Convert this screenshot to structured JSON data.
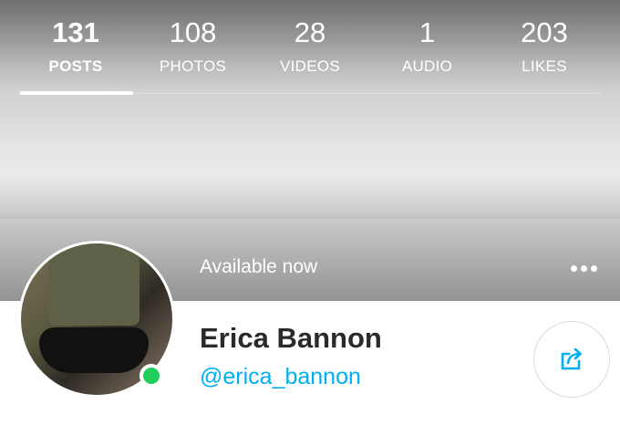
{
  "stats": [
    {
      "count": "131",
      "label": "POSTS",
      "active": true
    },
    {
      "count": "108",
      "label": "PHOTOS",
      "active": false
    },
    {
      "count": "28",
      "label": "VIDEOS",
      "active": false
    },
    {
      "count": "1",
      "label": "AUDIO",
      "active": false
    },
    {
      "count": "203",
      "label": "LIKES",
      "active": false
    }
  ],
  "cover": {
    "status_text": "Available now"
  },
  "menu": {
    "icon": "more-horizontal-icon"
  },
  "profile": {
    "name": "Erica Bannon",
    "handle": "@erica_bannon",
    "online": true
  },
  "share": {
    "icon": "share-icon"
  },
  "colors": {
    "accent": "#00aff0",
    "online": "#1fcf5a",
    "name": "#2a2a2a"
  }
}
